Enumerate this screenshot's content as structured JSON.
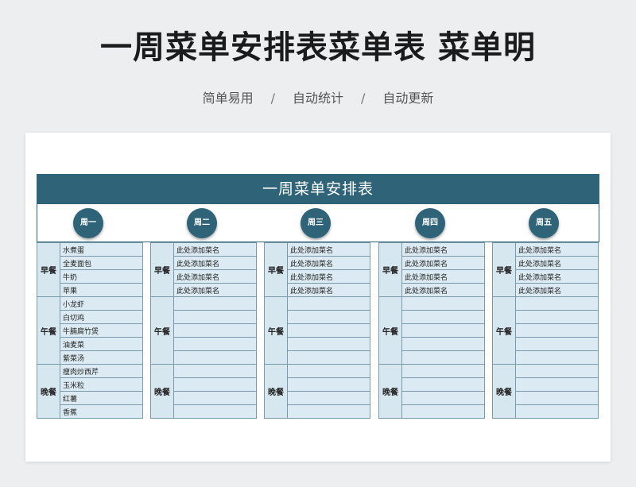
{
  "page": {
    "title": "一周菜单安排表菜单表 菜单明",
    "subtitle": [
      "简单易用",
      "自动统计",
      "自动更新"
    ],
    "separator": "/"
  },
  "sheet": {
    "title": "一周菜单安排表",
    "meal_labels": [
      "早餐",
      "午餐",
      "晚餐"
    ],
    "days": [
      {
        "name": "周一",
        "meals": [
          [
            "水煮蛋",
            "全麦面包",
            "牛奶",
            "苹果"
          ],
          [
            "小龙虾",
            "白切鸡",
            "牛腩腐竹煲",
            "油麦菜",
            "紫菜汤"
          ],
          [
            "瘦肉炒西芹",
            "玉米粒",
            "红薯",
            "香蕉"
          ]
        ]
      },
      {
        "name": "周二",
        "meals": [
          [
            "此处添加菜名",
            "此处添加菜名",
            "此处添加菜名",
            "此处添加菜名"
          ],
          [
            "",
            "",
            "",
            "",
            ""
          ],
          [
            "",
            "",
            "",
            ""
          ]
        ]
      },
      {
        "name": "周三",
        "meals": [
          [
            "此处添加菜名",
            "此处添加菜名",
            "此处添加菜名",
            "此处添加菜名"
          ],
          [
            "",
            "",
            "",
            "",
            ""
          ],
          [
            "",
            "",
            "",
            ""
          ]
        ]
      },
      {
        "name": "周四",
        "meals": [
          [
            "此处添加菜名",
            "此处添加菜名",
            "此处添加菜名",
            "此处添加菜名"
          ],
          [
            "",
            "",
            "",
            "",
            ""
          ],
          [
            "",
            "",
            "",
            ""
          ]
        ]
      },
      {
        "name": "周五",
        "meals": [
          [
            "此处添加菜名",
            "此处添加菜名",
            "此处添加菜名",
            "此处添加菜名"
          ],
          [
            "",
            "",
            "",
            "",
            ""
          ],
          [
            "",
            "",
            "",
            ""
          ]
        ]
      }
    ]
  }
}
